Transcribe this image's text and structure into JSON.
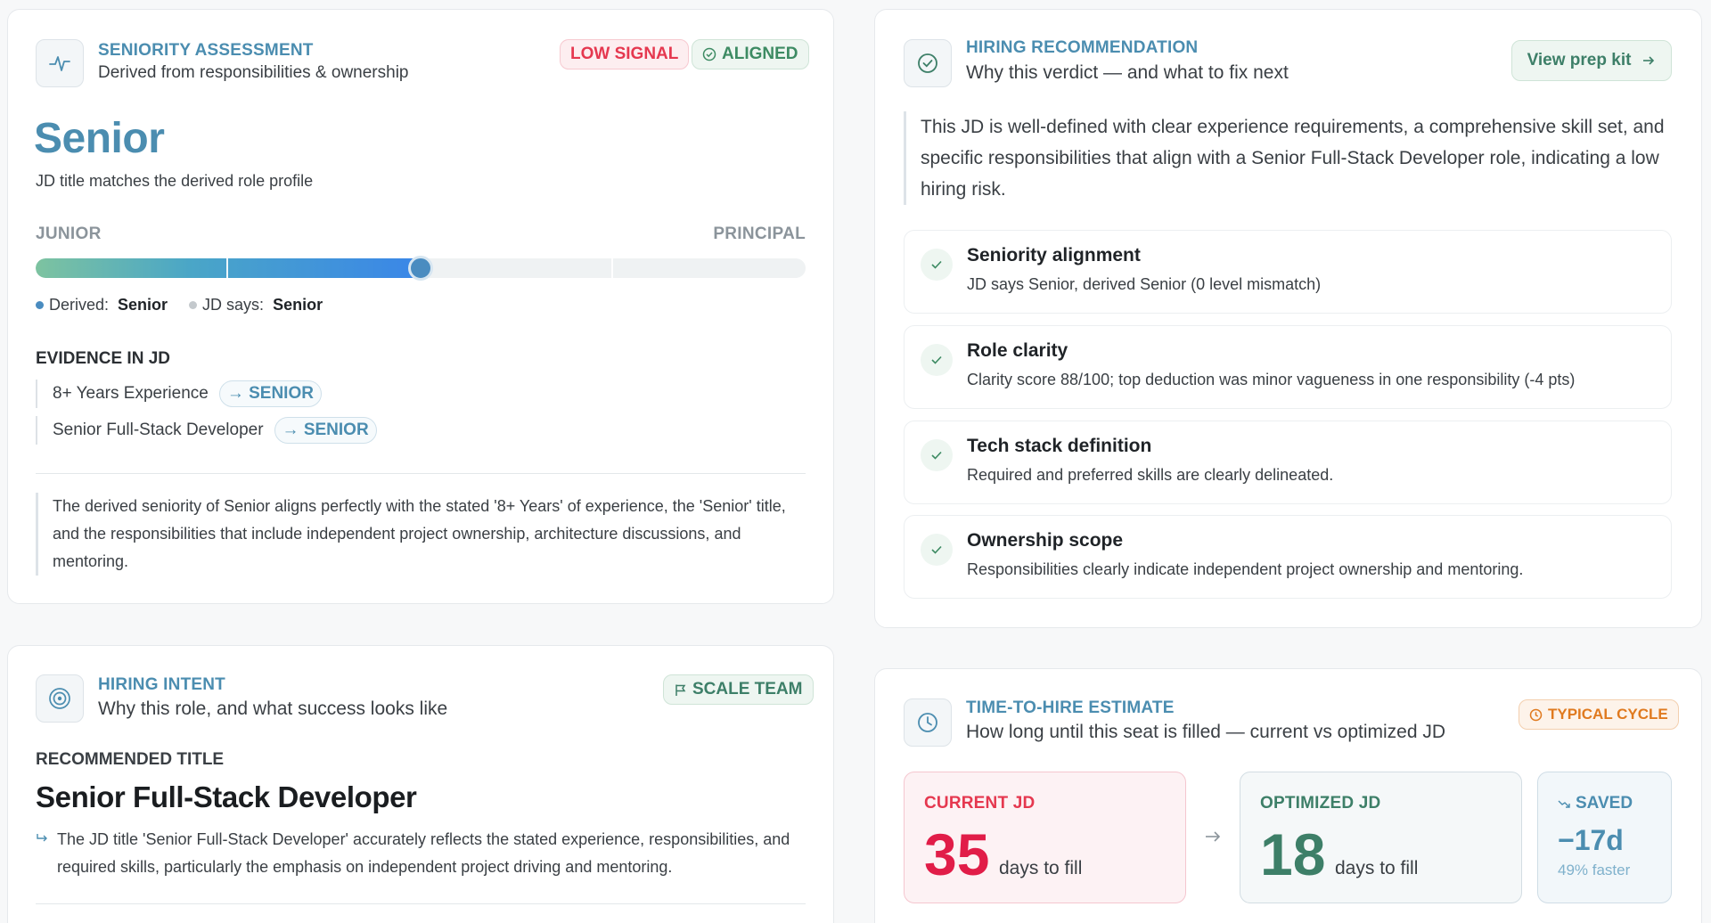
{
  "seniority": {
    "eyebrow": "SENIORITY ASSESSMENT",
    "subtitle": "Derived from responsibilities & ownership",
    "badge_low": "LOW SIGNAL",
    "badge_aligned": "ALIGNED",
    "level": "Senior",
    "level_note": "JD title matches the derived role profile",
    "scale_min": "JUNIOR",
    "scale_max": "PRINCIPAL",
    "level_fraction": 0.5,
    "derived_label": "Derived:",
    "derived_value": "Senior",
    "jd_label": "JD says:",
    "jd_value": "Senior",
    "evidence_heading": "EVIDENCE IN JD",
    "evidence": [
      {
        "text": "8+ Years Experience",
        "tag": "→ SENIOR"
      },
      {
        "text": "Senior Full-Stack Developer",
        "tag": "→ SENIOR"
      }
    ],
    "summary": "The derived seniority of Senior aligns perfectly with the stated '8+ Years' of experience, the 'Senior' title, and the responsibilities that include independent project ownership, architecture discussions, and mentoring.",
    "colors": {
      "accent": "#4b8db0",
      "knob": "#4a8cc0",
      "low_signal": "#e5384f",
      "aligned": "#3d8b63"
    }
  },
  "recommendation": {
    "eyebrow": "HIRING RECOMMENDATION",
    "subtitle": "Why this verdict — and what to fix next",
    "button": "View prep kit",
    "summary": "This JD is well-defined with clear experience requirements, a comprehensive skill set, and specific responsibilities that align with a Senior Full-Stack Developer role, indicating a low hiring risk.",
    "checks": [
      {
        "title": "Seniority alignment",
        "desc": "JD says Senior, derived Senior (0 level mismatch)"
      },
      {
        "title": "Role clarity",
        "desc": "Clarity score 88/100; top deduction was minor vagueness in one responsibility (-4 pts)"
      },
      {
        "title": "Tech stack definition",
        "desc": "Required and preferred skills are clearly delineated."
      },
      {
        "title": "Ownership scope",
        "desc": "Responsibilities clearly indicate independent project ownership and mentoring."
      }
    ]
  },
  "intent": {
    "eyebrow": "HIRING INTENT",
    "subtitle": "Why this role, and what success looks like",
    "badge": "SCALE TEAM",
    "rec_label": "RECOMMENDED TITLE",
    "rec_title": "Senior Full-Stack Developer",
    "rec_note": "The JD title 'Senior Full-Stack Developer' accurately reflects the stated experience, responsibilities, and required skills, particularly the emphasis on independent project driving and mentoring."
  },
  "time_to_hire": {
    "eyebrow": "TIME-TO-HIRE ESTIMATE",
    "subtitle": "How long until this seat is filled — current vs optimized JD",
    "badge": "TYPICAL CYCLE",
    "current_label": "CURRENT JD",
    "current_value": "35",
    "current_unit": "days to fill",
    "optimized_label": "OPTIMIZED JD",
    "optimized_value": "18",
    "optimized_unit": "days to fill",
    "saved_label": "SAVED",
    "saved_value": "−17d",
    "saved_note": "49% faster",
    "colors": {
      "current": "#e11d48",
      "optimized": "#3d7f68",
      "saved": "#4b8db0",
      "badge": "#e07a1f"
    }
  }
}
